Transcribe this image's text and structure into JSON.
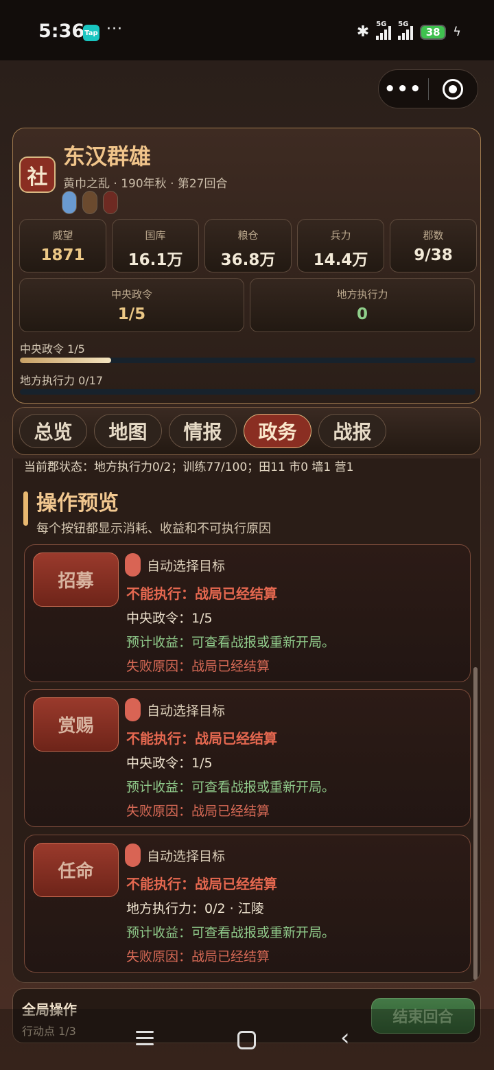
{
  "statusbar": {
    "time": "5:36",
    "app_badge": "Tap",
    "more": "···",
    "signal_label_1": "5G",
    "signal_label_2": "5G",
    "battery": "38",
    "icons": [
      "bluetooth-icon",
      "signal-icon",
      "signal-icon",
      "battery-icon",
      "charging-icon"
    ]
  },
  "capsule": {
    "more": "•••",
    "icons": [
      "more-icon",
      "target-icon"
    ]
  },
  "header": {
    "badge": "社",
    "name": "东汉群雄",
    "subtitle": "黄巾之乱 · 190年秋 · 第27回合",
    "pill_colors": [
      "#6a9ad0",
      "#6b4a2e",
      "#6e2a22"
    ],
    "stats": [
      {
        "label": "威望",
        "value": "1871"
      },
      {
        "label": "国库",
        "value": "16.1万"
      },
      {
        "label": "粮仓",
        "value": "36.8万"
      },
      {
        "label": "兵力",
        "value": "14.4万"
      },
      {
        "label": "郡数",
        "value": "9/38"
      }
    ],
    "orders": [
      {
        "label": "中央政令",
        "value": "1/5"
      },
      {
        "label": "地方执行力",
        "value": "0"
      }
    ],
    "bars": [
      {
        "label": "中央政令 1/5",
        "fraction": 0.2
      },
      {
        "label": "地方执行力 0/17",
        "fraction": 0
      }
    ]
  },
  "tabs": [
    {
      "label": "总览",
      "active": false
    },
    {
      "label": "地图",
      "active": false
    },
    {
      "label": "情报",
      "active": false
    },
    {
      "label": "政务",
      "active": true
    },
    {
      "label": "战报",
      "active": false
    }
  ],
  "panel": {
    "status_line": "当前郡状态：地方执行力0/2；训练77/100；田11 市0 墙1 营1",
    "title": "操作预览",
    "subtitle": "每个按钮都显示消耗、收益和不可执行原因",
    "actions": [
      {
        "button": "招募",
        "target": "自动选择目标",
        "error": "不能执行：战局已经结算",
        "cost": "中央政令：1/5",
        "gain": "预计收益：可查看战报或重新开局。",
        "fail": "失败原因：战局已经结算"
      },
      {
        "button": "赏赐",
        "target": "自动选择目标",
        "error": "不能执行：战局已经结算",
        "cost": "中央政令：1/5",
        "gain": "预计收益：可查看战报或重新开局。",
        "fail": "失败原因：战局已经结算"
      },
      {
        "button": "任命",
        "target": "自动选择目标",
        "error": "不能执行：战局已经结算",
        "cost": "地方执行力：0/2 · 江陵",
        "gain": "预计收益：可查看战报或重新开局。",
        "fail": "失败原因：战局已经结算"
      }
    ]
  },
  "global": {
    "title": "全局操作",
    "sub": "行动点 1/3",
    "end_button": "结束回合"
  },
  "navbar": {
    "icons": [
      "menu-icon",
      "home-icon",
      "back-icon"
    ],
    "back": "‹"
  }
}
